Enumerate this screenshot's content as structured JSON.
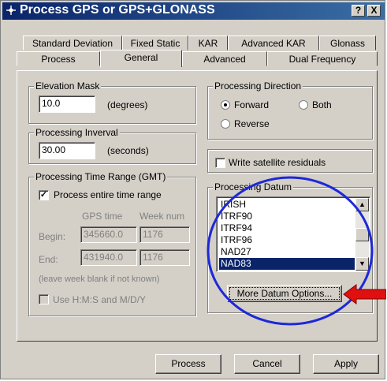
{
  "window": {
    "title": "Process GPS or GPS+GLONASS",
    "help_label": "?",
    "close_label": "X"
  },
  "tabs_row1": [
    "Standard Deviation",
    "Fixed Static",
    "KAR",
    "Advanced KAR",
    "Glonass"
  ],
  "tabs_row2": [
    "Process",
    "General",
    "Advanced",
    "Dual Frequency"
  ],
  "elevation": {
    "label": "Elevation Mask",
    "value": "10.0",
    "unit": "(degrees)"
  },
  "interval": {
    "label": "Processing Inverval",
    "value": "30.00",
    "unit": "(seconds)"
  },
  "time_range": {
    "label": "Processing Time Range (GMT)",
    "entire_label": "Process entire time range",
    "col_gps": "GPS time",
    "col_week": "Week num",
    "begin_label": "Begin:",
    "begin_time": "345660.0",
    "begin_week": "1176",
    "end_label": "End:",
    "end_time": "431940.0",
    "end_week": "1176",
    "note": "(leave week blank if not known)",
    "hms_label": "Use H:M:S and M/D/Y"
  },
  "direction": {
    "label": "Processing Direction",
    "forward": "Forward",
    "both": "Both",
    "reverse": "Reverse"
  },
  "residuals_label": "Write satellite residuals",
  "datum": {
    "label": "Processing Datum",
    "items": [
      "IRISH",
      "ITRF90",
      "ITRF94",
      "ITRF96",
      "NAD27",
      "NAD83"
    ],
    "selected": "NAD83",
    "more_button": "More Datum Options..."
  },
  "buttons": {
    "process": "Process",
    "cancel": "Cancel",
    "apply": "Apply"
  },
  "annotation_colors": {
    "circle": "#1d28d8",
    "arrow": "#e01010"
  }
}
